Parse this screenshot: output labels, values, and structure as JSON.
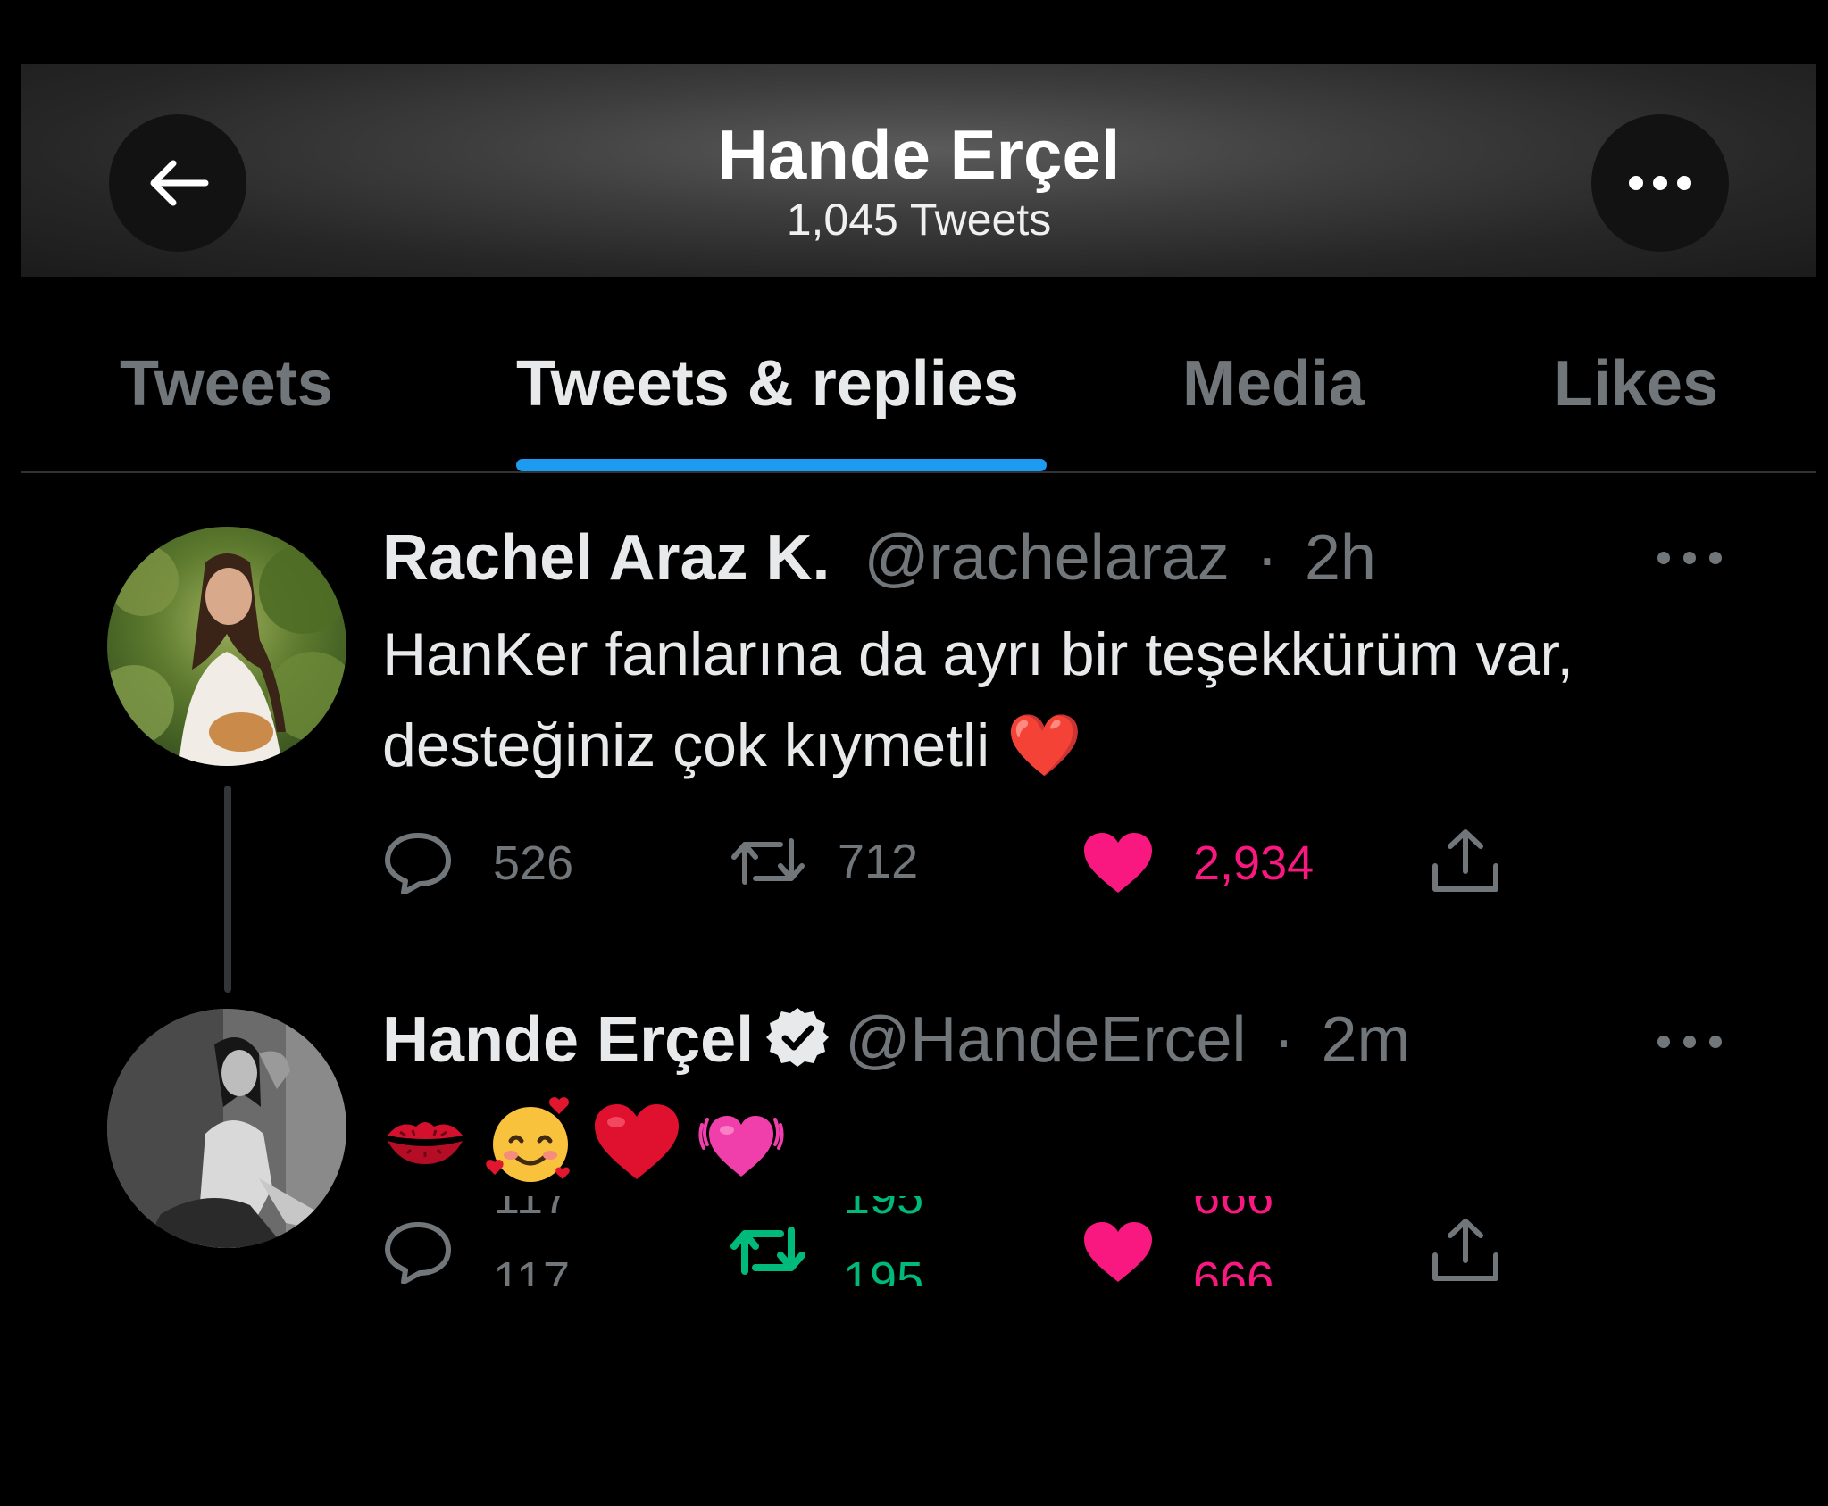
{
  "header": {
    "title": "Hande Erçel",
    "subtitle": "1,045 Tweets",
    "back_icon": "arrow-left-icon",
    "more_icon": "more-horizontal-icon"
  },
  "tabs": [
    {
      "label": "Tweets",
      "active": false
    },
    {
      "label": "Tweets & replies",
      "active": true
    },
    {
      "label": "Media",
      "active": false
    },
    {
      "label": "Likes",
      "active": false
    }
  ],
  "colors": {
    "accent": "#1d9bf0",
    "like": "#f91880",
    "retweet": "#00ba7c",
    "muted": "#71767b",
    "text": "#e7e9ea",
    "background": "#000000"
  },
  "tweets": [
    {
      "name": "Rachel Araz K.",
      "handle": "@rachelaraz",
      "separator": "·",
      "time": "2h",
      "verified": false,
      "text": "HanKer fanlarına da ayrı bir teşekkürüm var, desteğiniz çok kıymetli ❤️",
      "emoji": "❤️",
      "replies": "526",
      "retweets": "712",
      "likes": "2,934",
      "liked": true,
      "retweeted": false
    },
    {
      "name": "Hande Erçel",
      "handle": "@HandeErcel",
      "separator": "·",
      "time": "2m",
      "verified": true,
      "emojis": [
        "💋",
        "🥰",
        "❤️",
        "💓"
      ],
      "replies": "117",
      "retweets": "195",
      "likes": "666",
      "liked": true,
      "retweeted": true
    }
  ]
}
